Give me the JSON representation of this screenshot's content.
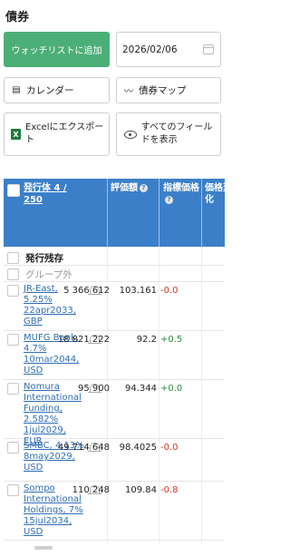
{
  "page_title": "債券",
  "toolbar": {
    "watchlist_add": "ウォッチリストに追加",
    "date_value": "2026/02/06",
    "calendar": "カレンダー",
    "bond_map": "債券マップ",
    "export_excel": "Excelにエクスポート",
    "show_all_fields": "すべてのフィールドを表示"
  },
  "table": {
    "headers": {
      "issuer": "発行体 4 / 250",
      "valuation": "評価額",
      "indicative_price": "指標価格",
      "change": "価格変化"
    },
    "group": {
      "label": "発行残存",
      "sub": "グループ外"
    },
    "rows": [
      {
        "name": "JR-East, 5.25% 22apr2033, GBP",
        "amount": "5 366 612",
        "price": "103.161",
        "change": "-0.0",
        "sign": "neg"
      },
      {
        "name": "MUFG Bank, 4.7% 10mar2044, USD",
        "amount": "18 821 222",
        "price": "92.2",
        "change": "+0.5",
        "sign": "pos"
      },
      {
        "name": "Nomura International Funding, 2.582% 1jul2029, EUR",
        "amount": "95 900",
        "price": "94.344",
        "change": "+0.0",
        "sign": "pos"
      },
      {
        "name": "SMBC, 4.13% 8may2029, USD",
        "amount": "49 714 648",
        "price": "98.4025",
        "change": "-0.0",
        "sign": "neg"
      },
      {
        "name": "Sompo International Holdings, 7% 15jul2034, USD",
        "amount": "110 248",
        "price": "109.84",
        "change": "-0.8",
        "sign": "neg"
      }
    ]
  }
}
